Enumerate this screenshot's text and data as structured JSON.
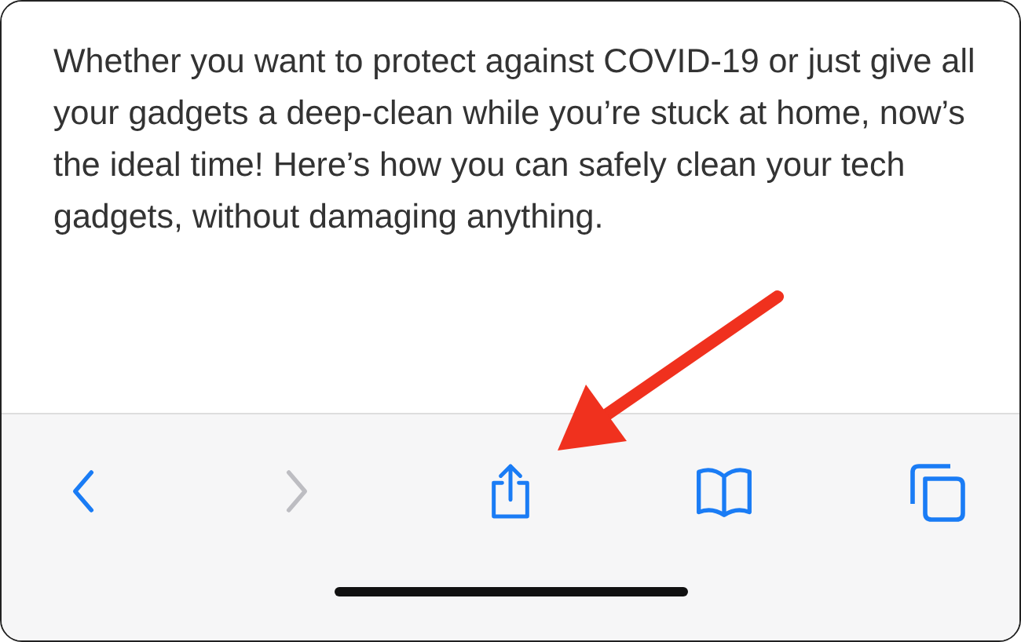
{
  "article": {
    "text": "Whether you want to protect against COVID-19 or just give all your gadgets a deep-clean while you’re stuck at home, now’s the ideal time! Here’s how you can safely clean your tech gadgets, without damaging anything."
  },
  "toolbar": [
    {
      "kind": "back",
      "disabled": false
    },
    {
      "kind": "forward",
      "disabled": true
    },
    {
      "kind": "share",
      "disabled": false
    },
    {
      "kind": "bookmarks",
      "disabled": false
    },
    {
      "kind": "tabs",
      "disabled": false
    }
  ]
}
